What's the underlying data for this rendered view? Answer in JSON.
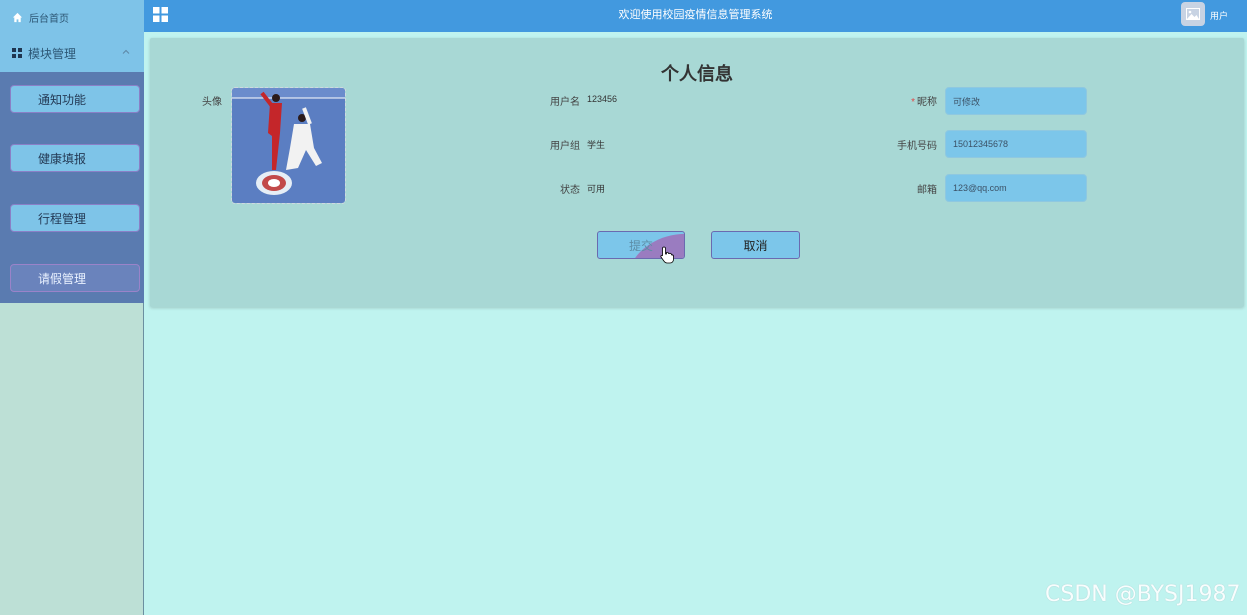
{
  "sidebar": {
    "home_label": "后台首页",
    "module_label": "模块管理",
    "items": [
      {
        "label": "通知功能"
      },
      {
        "label": "健康填报"
      },
      {
        "label": "行程管理"
      },
      {
        "label": "请假管理"
      }
    ]
  },
  "header": {
    "title": "欢迎使用校园疫情信息管理系统",
    "user_label": "用户"
  },
  "profile": {
    "title": "个人信息",
    "avatar_label": "头像",
    "username_label": "用户名",
    "username_value": "123456",
    "group_label": "用户组",
    "group_value": "学生",
    "status_label": "状态",
    "status_value": "可用",
    "nickname_label": "昵称",
    "nickname_required": "*",
    "nickname_placeholder": "可修改",
    "phone_label": "手机号码",
    "phone_value": "15012345678",
    "email_label": "邮箱",
    "email_value": "123@qq.com"
  },
  "actions": {
    "submit_label": "提交",
    "cancel_label": "取消"
  },
  "watermark": "CSDN @BYSJ1987",
  "colors": {
    "header": "#4299df",
    "sidebar_menu": "#5a7bb0",
    "panel": "#a8d8d5",
    "page_bg": "#bff3ef",
    "input_bg": "#7cc6ea"
  }
}
